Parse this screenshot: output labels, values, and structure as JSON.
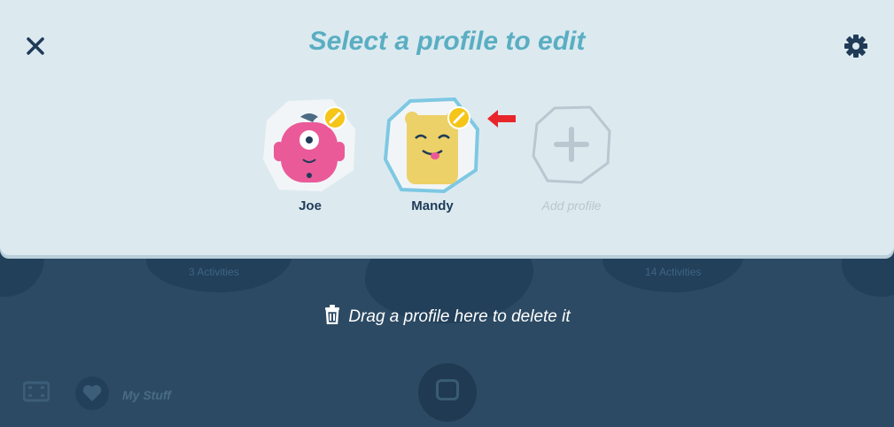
{
  "background": {
    "activity_labels": [
      "3 Activities",
      "14 Activities"
    ],
    "nav": {
      "my_stuff_label": "My Stuff"
    }
  },
  "modal": {
    "title": "Select a profile to edit",
    "close_icon": "close-icon",
    "settings_icon": "gear-icon",
    "profiles": [
      {
        "name": "Joe",
        "color": "#ea5a98",
        "selected": false
      },
      {
        "name": "Mandy",
        "color": "#ecd168",
        "selected": true
      }
    ],
    "add_profile_label": "Add profile"
  },
  "delete_zone": {
    "text": "Drag a profile here to delete it",
    "icon": "trash-icon"
  },
  "colors": {
    "accent": "#5aaec2",
    "badge": "#f5c518",
    "panel": "#dceaf0",
    "backdrop": "#2c4a63"
  }
}
